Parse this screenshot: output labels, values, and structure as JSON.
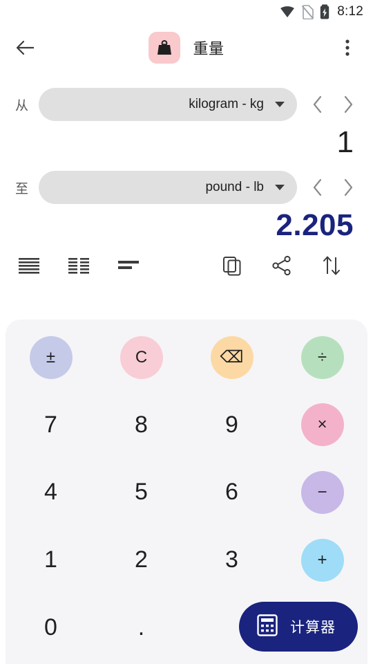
{
  "statusbar": {
    "time": "8:12",
    "icons": [
      "wifi-icon",
      "sim-off-icon",
      "battery-charging-icon"
    ]
  },
  "appbar": {
    "back_label": "back-arrow",
    "title": "重量",
    "badge_icon": "weight-icon",
    "overflow_label": "more-options"
  },
  "converter": {
    "from": {
      "label": "从",
      "unit": "kilogram - kg",
      "value": "1"
    },
    "to": {
      "label": "至",
      "unit": "pound - lb",
      "value": "2.205"
    },
    "prev_label": "‹",
    "next_label": "›"
  },
  "tools": {
    "left": [
      {
        "name": "format-align-justify-icon"
      },
      {
        "name": "format-columns-icon"
      },
      {
        "name": "format-compact-icon"
      }
    ],
    "right": [
      {
        "name": "copy-icon"
      },
      {
        "name": "share-icon"
      },
      {
        "name": "swap-vertical-icon"
      }
    ]
  },
  "keypad": {
    "keys": [
      {
        "label": "±",
        "name": "plus-minus-key",
        "style": "c-plusminus",
        "kind": "circle"
      },
      {
        "label": "C",
        "name": "clear-key",
        "style": "c-clear",
        "kind": "circle"
      },
      {
        "label": "⌫",
        "name": "backspace-key",
        "style": "c-back",
        "kind": "circle"
      },
      {
        "label": "÷",
        "name": "divide-key",
        "style": "c-div",
        "kind": "circle"
      },
      {
        "label": "7",
        "name": "digit-7-key",
        "style": "",
        "kind": "digit"
      },
      {
        "label": "8",
        "name": "digit-8-key",
        "style": "",
        "kind": "digit"
      },
      {
        "label": "9",
        "name": "digit-9-key",
        "style": "",
        "kind": "digit"
      },
      {
        "label": "×",
        "name": "multiply-key",
        "style": "c-mul",
        "kind": "circle"
      },
      {
        "label": "4",
        "name": "digit-4-key",
        "style": "",
        "kind": "digit"
      },
      {
        "label": "5",
        "name": "digit-5-key",
        "style": "",
        "kind": "digit"
      },
      {
        "label": "6",
        "name": "digit-6-key",
        "style": "",
        "kind": "digit"
      },
      {
        "label": "−",
        "name": "minus-key",
        "style": "c-sub",
        "kind": "circle"
      },
      {
        "label": "1",
        "name": "digit-1-key",
        "style": "",
        "kind": "digit"
      },
      {
        "label": "2",
        "name": "digit-2-key",
        "style": "",
        "kind": "digit"
      },
      {
        "label": "3",
        "name": "digit-3-key",
        "style": "",
        "kind": "digit"
      },
      {
        "label": "+",
        "name": "plus-key",
        "style": "c-add",
        "kind": "circle"
      },
      {
        "label": "0",
        "name": "digit-0-key",
        "style": "",
        "kind": "digit"
      },
      {
        "label": ".",
        "name": "decimal-key",
        "style": "",
        "kind": "digit"
      },
      {
        "label": "",
        "name": "empty-key",
        "style": "",
        "kind": "blank"
      },
      {
        "label": "",
        "name": "empty-key",
        "style": "",
        "kind": "blank"
      }
    ]
  },
  "calculator_button": {
    "label": "计算器",
    "icon": "calculator-icon"
  },
  "colors": {
    "accent": "#1a237e",
    "keypad_bg": "#f5f5f7",
    "select_bg": "#e0e0e0"
  }
}
